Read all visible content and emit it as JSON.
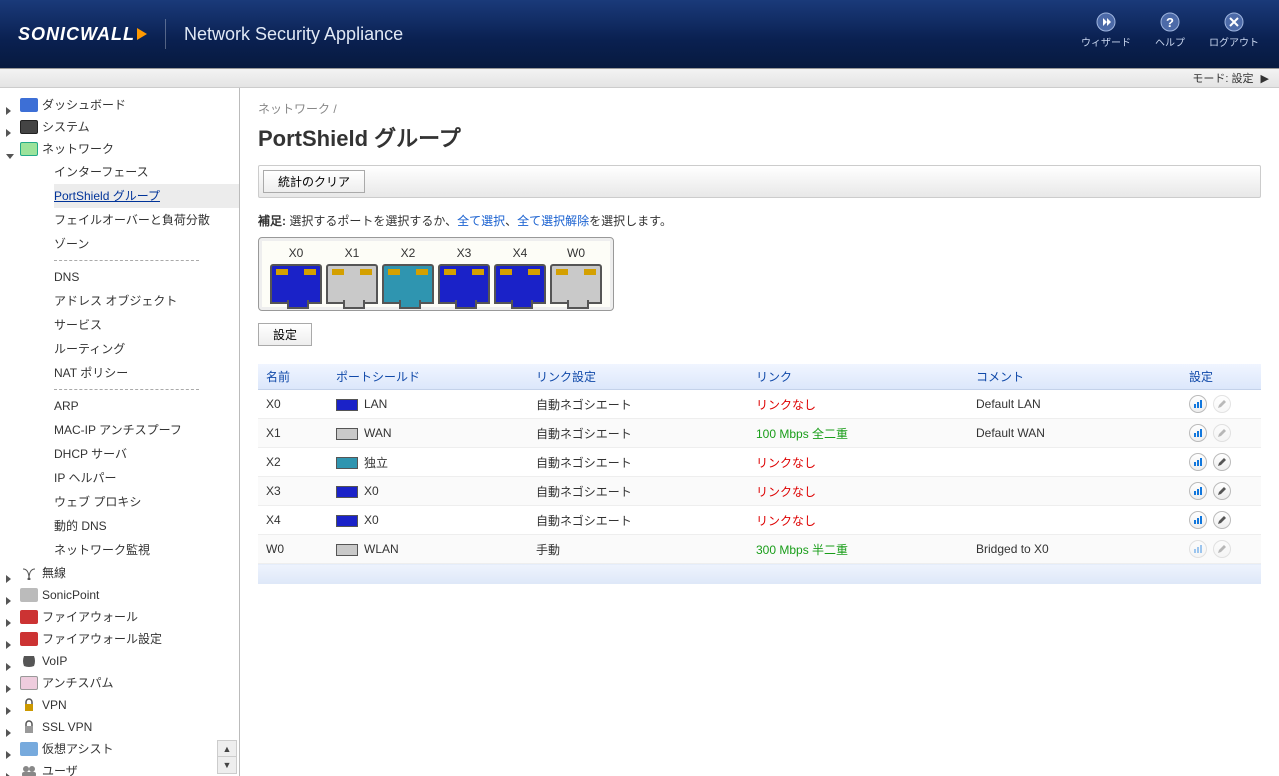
{
  "header": {
    "logo": "SONICWALL",
    "title": "Network Security Appliance",
    "actions": {
      "wizard": "ウィザード",
      "help": "ヘルプ",
      "logout": "ログアウト"
    }
  },
  "mode_bar": {
    "label": "モード:",
    "value": "設定"
  },
  "sidebar": {
    "dashboard": "ダッシュボード",
    "system": "システム",
    "network": "ネットワーク",
    "network_children": {
      "interfaces": "インターフェース",
      "portshield": "PortShield グループ",
      "failover": "フェイルオーバーと負荷分散",
      "zones": "ゾーン",
      "dns": "DNS",
      "addr": "アドレス オブジェクト",
      "services": "サービス",
      "routing": "ルーティング",
      "nat": "NAT ポリシー",
      "arp": "ARP",
      "macip": "MAC-IP アンチスプーフ",
      "dhcp": "DHCP サーバ",
      "iphelper": "IP ヘルパー",
      "webproxy": "ウェブ プロキシ",
      "ddns": "動的 DNS",
      "monitor": "ネットワーク監視"
    },
    "wireless": "無線",
    "sonicpoint": "SonicPoint",
    "firewall": "ファイアウォール",
    "fwsettings": "ファイアウォール設定",
    "voip": "VoIP",
    "antispam": "アンチスパム",
    "vpn": "VPN",
    "sslvpn": "SSL VPN",
    "vassist": "仮想アシスト",
    "user": "ユーザ"
  },
  "content": {
    "breadcrumb": "ネットワーク /",
    "title": "PortShield グループ",
    "clear_stats": "統計のクリア",
    "hint_bold": "補足:",
    "hint_a": " 選択するポートを選択するか、",
    "hint_select_all": "全て選択",
    "hint_sep": "、",
    "hint_deselect_all": "全て選択解除",
    "hint_b": "を選択します。",
    "settings_btn": "設定"
  },
  "ports": [
    "X0",
    "X1",
    "X2",
    "X3",
    "X4",
    "W0"
  ],
  "table": {
    "headers": {
      "name": "名前",
      "portshield": "ポートシールド",
      "linkcfg": "リンク設定",
      "link": "リンク",
      "comment": "コメント",
      "settings": "設定"
    },
    "rows": [
      {
        "name": "X0",
        "sw": "sw-blue",
        "ps": "LAN",
        "linkcfg": "自動ネゴシエート",
        "link": "リンクなし",
        "lc": "link-nolink",
        "comment": "Default LAN",
        "s": true,
        "e": false
      },
      {
        "name": "X1",
        "sw": "sw-gray",
        "ps": "WAN",
        "linkcfg": "自動ネゴシエート",
        "link": "100 Mbps 全二重",
        "lc": "link-green",
        "comment": "Default WAN",
        "s": true,
        "e": false
      },
      {
        "name": "X2",
        "sw": "sw-teal",
        "ps": "独立",
        "linkcfg": "自動ネゴシエート",
        "link": "リンクなし",
        "lc": "link-nolink",
        "comment": "",
        "s": true,
        "e": true
      },
      {
        "name": "X3",
        "sw": "sw-blue",
        "ps": "X0",
        "linkcfg": "自動ネゴシエート",
        "link": "リンクなし",
        "lc": "link-nolink",
        "comment": "",
        "s": true,
        "e": true
      },
      {
        "name": "X4",
        "sw": "sw-blue",
        "ps": "X0",
        "linkcfg": "自動ネゴシエート",
        "link": "リンクなし",
        "lc": "link-nolink",
        "comment": "",
        "s": true,
        "e": true
      },
      {
        "name": "W0",
        "sw": "sw-gray",
        "ps": "WLAN",
        "linkcfg": "手動",
        "link": "300 Mbps 半二重",
        "lc": "link-green",
        "comment": "Bridged to X0",
        "s": false,
        "e": false
      }
    ]
  }
}
